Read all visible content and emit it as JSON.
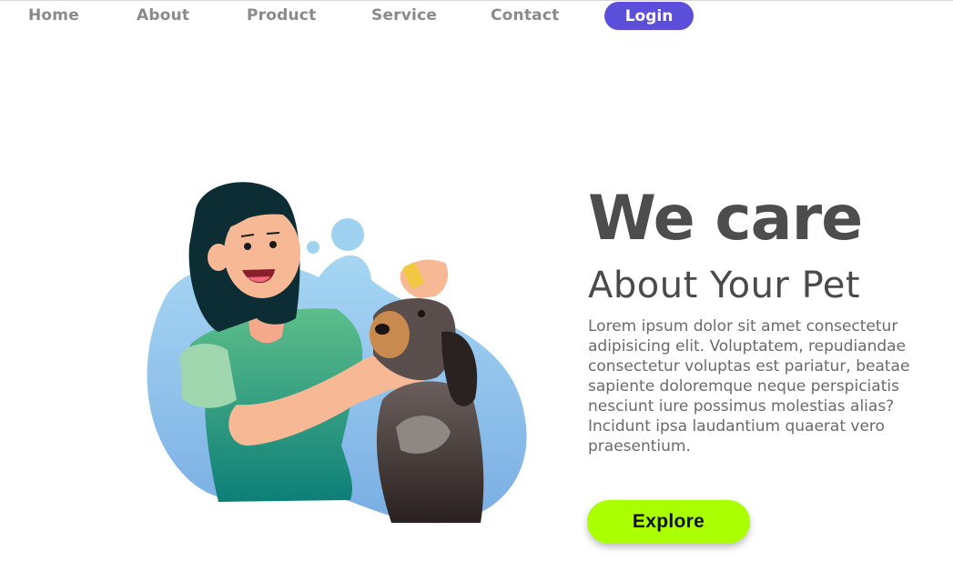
{
  "nav": {
    "items": [
      {
        "label": "Home"
      },
      {
        "label": "About"
      },
      {
        "label": "Product"
      },
      {
        "label": "Service"
      },
      {
        "label": "Contact"
      }
    ],
    "login_label": "Login"
  },
  "hero": {
    "title": "We care",
    "subtitle": "About Your Pet",
    "description": "Lorem ipsum dolor sit amet consectetur adipisicing elit. Voluptatem, repudiandae consectetur voluptas est pariatur, beatae sapiente doloremque neque perspiciatis nesciunt iure possimus molestias alias? Incidunt ipsa laudantium quaerat vero praesentium.",
    "cta_label": "Explore"
  },
  "colors": {
    "accent_login": "#5b4fd9",
    "accent_cta": "#aaff00",
    "blob": "#8ec8ee"
  },
  "illustration": {
    "icon": "vet-with-dog-illustration"
  }
}
